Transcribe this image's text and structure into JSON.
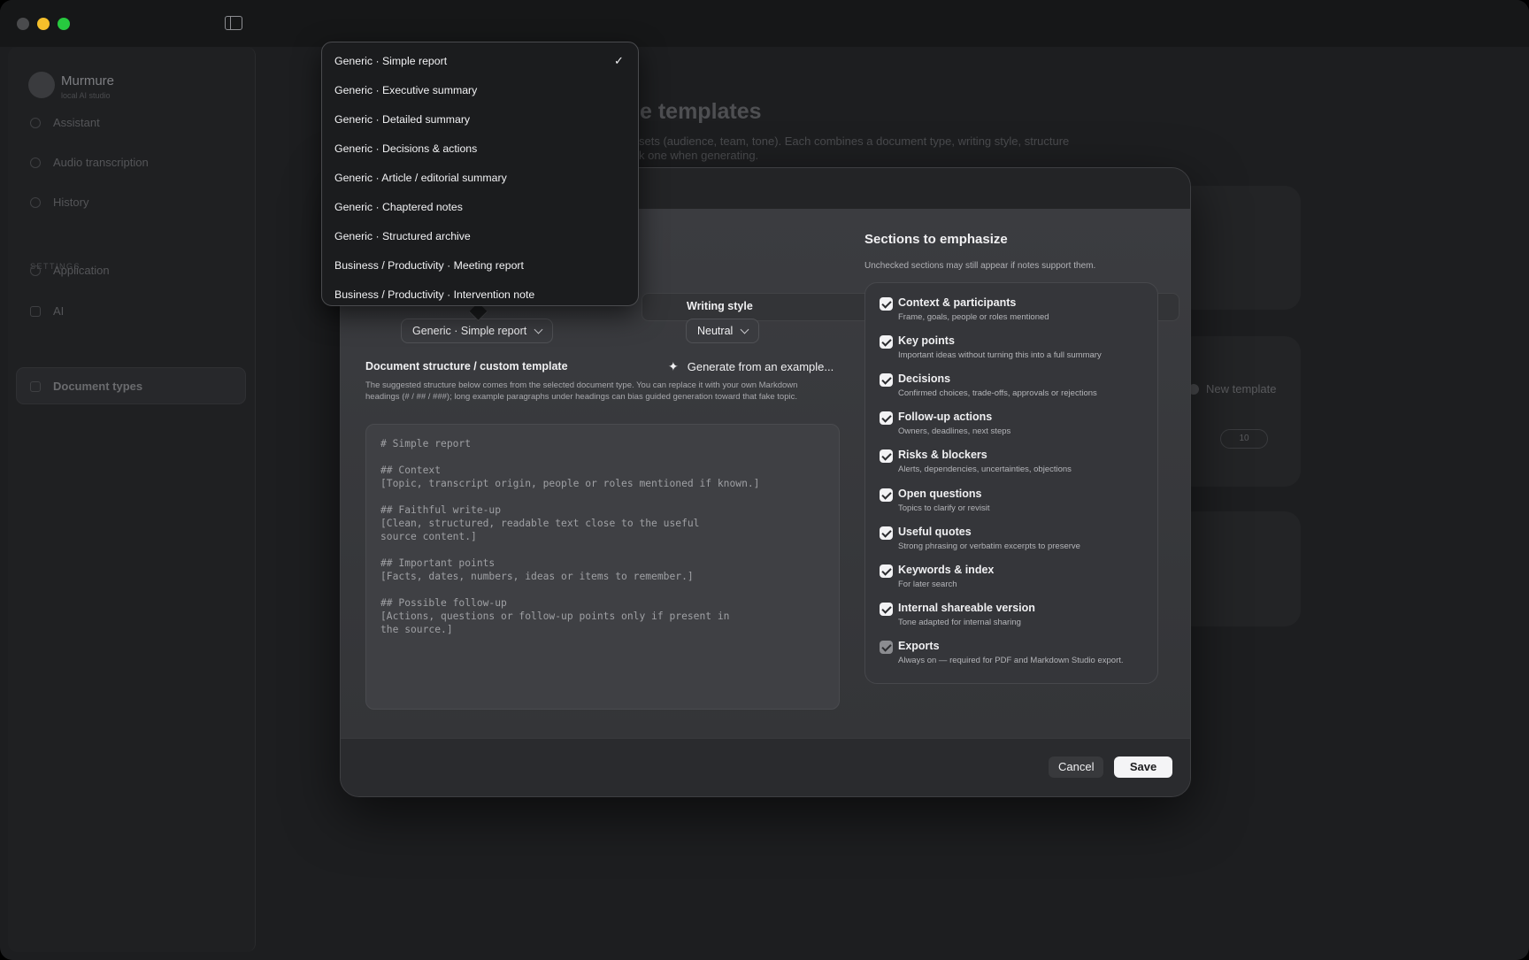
{
  "app": {
    "name": "Murmure",
    "tagline": "local AI studio"
  },
  "sidebar": {
    "items": [
      {
        "label": "Assistant"
      },
      {
        "label": "Audio transcription"
      },
      {
        "label": "History"
      }
    ],
    "settings_label": "SETTINGS",
    "settings_items": [
      {
        "label": "Application"
      },
      {
        "label": "AI"
      },
      {
        "label": "Document types"
      }
    ]
  },
  "background": {
    "title_fragment": "e templates",
    "desc_line1": "sets (audience, team, tone). Each combines a document type, writing style, structure",
    "desc_line2": "k one when generating.",
    "new_template": "New template",
    "count_badge": "10"
  },
  "editor_dialog": {
    "document_type_value": "Generic · Simple report",
    "writing_style_label": "Writing style",
    "writing_style_value": "Neutral",
    "structure_label": "Document structure / custom template",
    "generate_link": "Generate from an example...",
    "help_text": "The suggested structure below comes from the selected document type. You can replace it with your own Markdown headings (# / ## / ###); long example paragraphs under headings can bias guided generation toward that fake topic.",
    "template_text": "# Simple report\n\n## Context\n[Topic, transcript origin, people or roles mentioned if known.]\n\n## Faithful write-up\n[Clean, structured, readable text close to the useful\nsource content.]\n\n## Important points\n[Facts, dates, numbers, ideas or items to remember.]\n\n## Possible follow-up\n[Actions, questions or follow-up points only if present in\nthe source.]",
    "sections_title": "Sections to emphasize",
    "sections_subtitle": "Unchecked sections may still appear if notes support them.",
    "sections": [
      {
        "title": "Context & participants",
        "desc": "Frame, goals, people or roles mentioned",
        "checked": true
      },
      {
        "title": "Key points",
        "desc": "Important ideas without turning this into a full summary",
        "checked": true
      },
      {
        "title": "Decisions",
        "desc": "Confirmed choices, trade-offs, approvals or rejections",
        "checked": true
      },
      {
        "title": "Follow-up actions",
        "desc": "Owners, deadlines, next steps",
        "checked": true
      },
      {
        "title": "Risks & blockers",
        "desc": "Alerts, dependencies, uncertainties, objections",
        "checked": true
      },
      {
        "title": "Open questions",
        "desc": "Topics to clarify or revisit",
        "checked": true
      },
      {
        "title": "Useful quotes",
        "desc": "Strong phrasing or verbatim excerpts to preserve",
        "checked": true
      },
      {
        "title": "Keywords & index",
        "desc": "For later search",
        "checked": true
      },
      {
        "title": "Internal shareable version",
        "desc": "Tone adapted for internal sharing",
        "checked": true
      },
      {
        "title": "Exports",
        "desc": "Always on — required for PDF and Markdown Studio export.",
        "checked": true,
        "disabled": true
      }
    ],
    "cancel_label": "Cancel",
    "save_label": "Save"
  },
  "dropdown": {
    "selected_index": 0,
    "options": [
      "Generic · Simple report",
      "Generic · Executive summary",
      "Generic · Detailed summary",
      "Generic · Decisions & actions",
      "Generic · Article / editorial summary",
      "Generic · Chaptered notes",
      "Generic · Structured archive",
      "Business / Productivity · Meeting report",
      "Business / Productivity · Intervention note"
    ],
    "check_glyph": "✓"
  }
}
